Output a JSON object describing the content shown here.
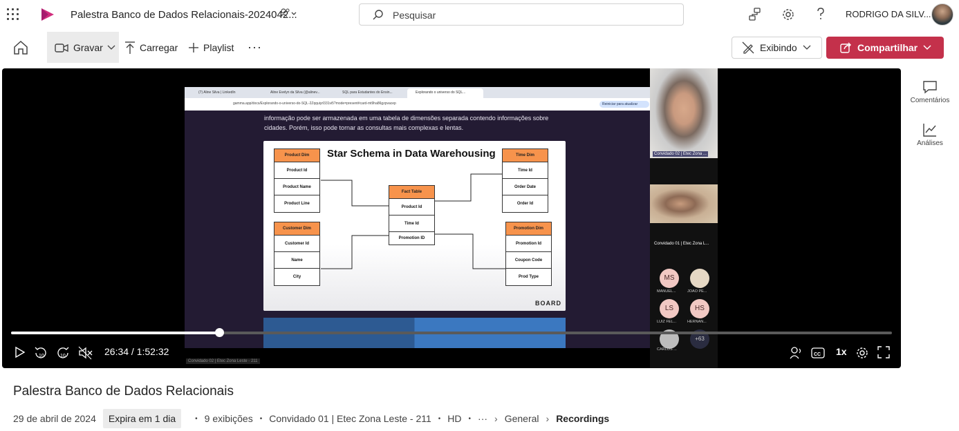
{
  "app": {
    "title": "Palestra Banco de Dados Relacionais-2024042...",
    "search_placeholder": "Pesquisar",
    "user_name": "RODRIGO DA SILV..."
  },
  "commands": {
    "gravar": "Gravar",
    "carregar": "Carregar",
    "playlist": "Playlist",
    "more": "···",
    "exibindo": "Exibindo",
    "compartilhar": "Compartilhar"
  },
  "browser": {
    "tabs": [
      "(7) Aline Silva | LinkedIn",
      "Aline Evelyn da Silva (@alinev...",
      "SQL para Estudantes do Ensin...",
      "Explorando o universo do SQL..."
    ],
    "url": "gamma.app/docs/Explorando-o-universo-do-SQL-2Zqquiyrl331vi5?mode=present#card-mt9ha86gzpvacep",
    "restart_button": "Reiniciar para atualizar"
  },
  "slide": {
    "paragraph": "informação pode ser armazenada em uma tabela de dimensões separada contendo informações sobre cidades. Porém, isso pode tornar as consultas mais complexas e lentas.",
    "diagram_title": "Star Schema in Data Warehousing",
    "brand": "BOARD",
    "tables": {
      "product": {
        "header": "Product Dim",
        "rows": [
          "Product Id",
          "Product Name",
          "Product Line"
        ]
      },
      "time": {
        "header": "Time Dim",
        "rows": [
          "Time Id",
          "Order Date",
          "Order Id"
        ]
      },
      "fact": {
        "header": "Fact Table",
        "rows": [
          "Product Id",
          "Time Id",
          "Promotion ID"
        ]
      },
      "customer": {
        "header": "Customer Dim",
        "rows": [
          "Customer Id",
          "Name",
          "City"
        ]
      },
      "promotion": {
        "header": "Promotion Dim",
        "rows": [
          "Promotion Id",
          "Coupon Code",
          "Prod Type"
        ]
      }
    },
    "screen_label": "Convidado 02 | Etec Zona Leste - 211"
  },
  "gallery": {
    "cam1_label": "Convidado 02 | Etec Zona ...",
    "cam2_label": "Convidado 01 | Etec Zona L...",
    "participants": [
      {
        "initials": "MS",
        "name": "MANUEL...",
        "color": "#f1c8c3"
      },
      {
        "initials": "",
        "name": "JOAO PE...",
        "color": "#e6d8c4"
      },
      {
        "initials": "LS",
        "name": "LUIZ FEL...",
        "color": "#f1c8c3"
      },
      {
        "initials": "HS",
        "name": "HERNAN...",
        "color": "#f1c8c3"
      },
      {
        "initials": "",
        "name": "CARLOS ...",
        "color": "#bdbdbd"
      },
      {
        "initials": "+63",
        "name": "",
        "color": "#2a2c40"
      }
    ]
  },
  "player": {
    "current_time": "26:34",
    "duration": "1:52:32",
    "time_display": "26:34 / 1:52:32",
    "progress_fraction": 0.236,
    "speed": "1x",
    "skip_back": "10",
    "skip_fwd": "10"
  },
  "rail": {
    "comments": "Comentários",
    "analytics": "Análises"
  },
  "video": {
    "title": "Palestra Banco de Dados Relacionais",
    "date": "29 de abril de 2024",
    "expires": "Expira em 1 dia",
    "views": "9 exibições",
    "owner": "Convidado 01 | Etec Zona Leste - 211",
    "quality": "HD",
    "crumb_general": "General",
    "crumb_recordings": "Recordings"
  },
  "colors": {
    "accent": "#c4314b",
    "orange": "#f7934c"
  }
}
